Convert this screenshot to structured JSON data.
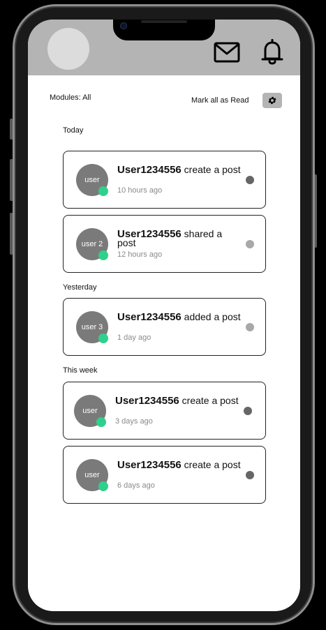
{
  "header": {
    "mail_icon": "mail-icon",
    "bell_icon": "bell-icon"
  },
  "toolbar": {
    "modules_label": "Modules: All",
    "mark_all_label": "Mark all as Read",
    "settings_icon": "gear-icon"
  },
  "sections": [
    {
      "label": "Today"
    },
    {
      "label": "Yesterday"
    },
    {
      "label": "This week"
    }
  ],
  "notifications": [
    {
      "avatar": "user",
      "user": "User1234556",
      "action": " create a post",
      "time": "10 hours ago",
      "dot_color": "#666666"
    },
    {
      "avatar": "user 2",
      "user": "User1234556",
      "action": " shared a post",
      "time": "12 hours ago",
      "dot_color": "#a8a8a8"
    },
    {
      "avatar": "user 3",
      "user": "User1234556",
      "action": "  added a post",
      "time": "1 day ago",
      "dot_color": "#a8a8a8"
    },
    {
      "avatar": "user",
      "user": "User1234556",
      "action": "  create a post",
      "time": "3 days ago",
      "dot_color": "#666666"
    },
    {
      "avatar": "user",
      "user": "User1234556",
      "action": "  create a post",
      "time": "6 days ago",
      "dot_color": "#666666"
    }
  ],
  "colors": {
    "header_bg": "#b4b4b4",
    "online": "#2fd08c",
    "avatar_bg": "#7a7a7a"
  }
}
